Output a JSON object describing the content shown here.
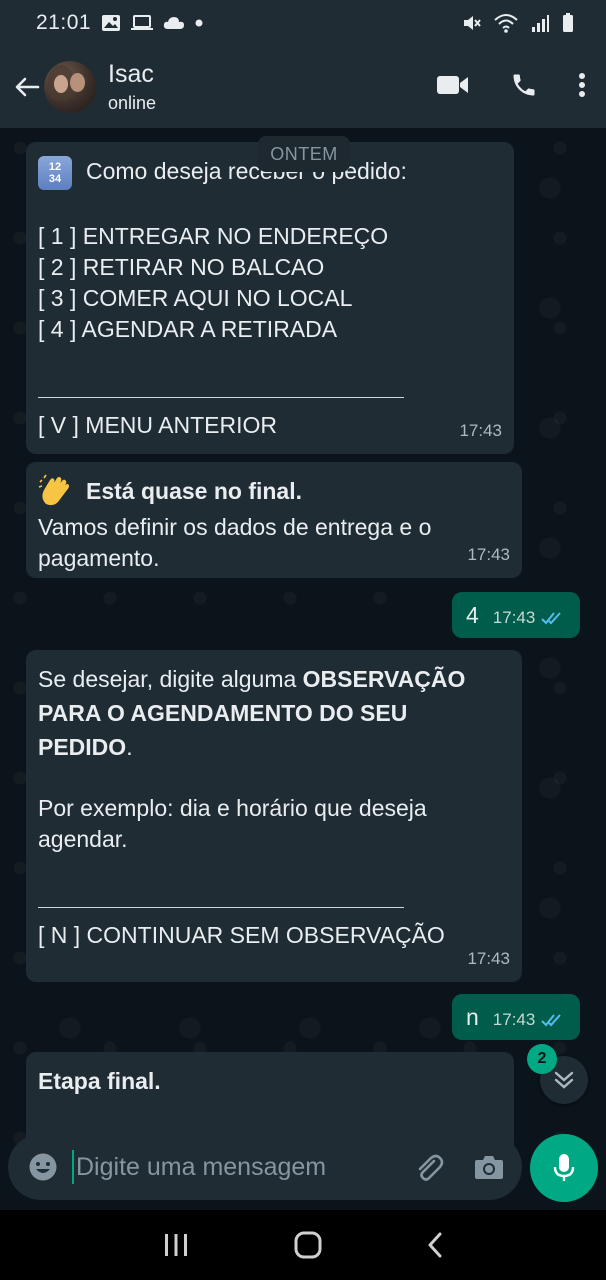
{
  "status_bar": {
    "time": "21:01"
  },
  "header": {
    "contact_name": "Isac",
    "contact_status": "online"
  },
  "chat": {
    "date_chip": "ONTEM",
    "messages": [
      {
        "direction": "in",
        "emoji": "1234-keycap",
        "lines": [
          "Como deseja receber o pedido:",
          "",
          "[ 1 ] ENTREGAR NO ENDEREÇO",
          "[ 2 ] RETIRAR NO BALCAO",
          "[ 3 ] COMER AQUI NO LOCAL",
          "[ 4 ] AGENDAR A RETIRADA"
        ],
        "footer": "[ V ] MENU ANTERIOR",
        "time": "17:43"
      },
      {
        "direction": "in",
        "emoji": "clapping-hands",
        "title": "Está quase no final.",
        "line1": "Vamos definir os dados de entrega e o",
        "line2": "pagamento.",
        "time": "17:43"
      },
      {
        "direction": "out",
        "text": "4",
        "time": "17:43",
        "read": true
      },
      {
        "direction": "in",
        "line1_plain": "Se desejar, digite alguma ",
        "line1_bold": "OBSERVAÇÃO",
        "line2_bold": "PARA O AGENDAMENTO DO SEU",
        "line3_bold": "PEDIDO",
        "line3_plain": ".",
        "line4": "Por exemplo: dia e horário que deseja",
        "line5": "agendar.",
        "footer": "[ N ] CONTINUAR SEM OBSERVAÇÃO",
        "time": "17:43"
      },
      {
        "direction": "out",
        "text": "n",
        "time": "17:43",
        "read": true
      },
      {
        "direction": "in",
        "title": "Etapa final."
      }
    ],
    "unread_count": "2"
  },
  "input": {
    "placeholder": "Digite uma mensagem"
  },
  "colors": {
    "accent": "#00a884",
    "bubble_in": "#1f2c34",
    "bubble_out": "#005c4b",
    "read_ticks": "#53bdeb"
  }
}
